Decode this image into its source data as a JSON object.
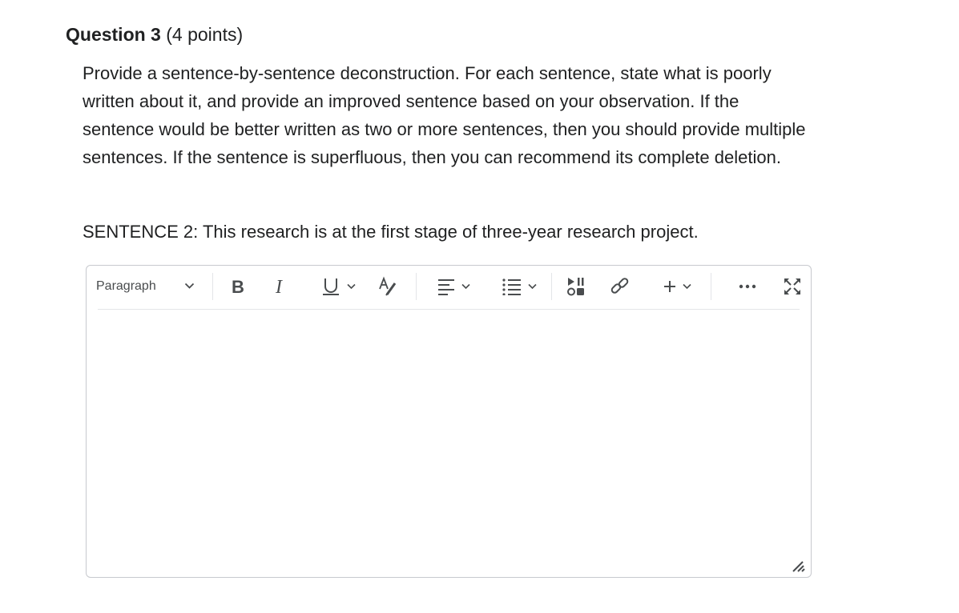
{
  "question": {
    "title": "Question 3",
    "points": "(4 points)",
    "prompt": "Provide a sentence-by-sentence deconstruction. For each sentence, state what is poorly written about it, and provide an improved sentence based on your observation. If the sentence would be better written as two or more sentences, then you should provide multiple sentences. If the sentence is superfluous, then you can recommend its complete deletion.",
    "sentence": "SENTENCE 2: This research is at the first stage of three-year research project."
  },
  "editor": {
    "format_select": "Paragraph",
    "body_text": "",
    "toolbar_icons": [
      "bold-icon",
      "italic-icon",
      "underline-icon",
      "text-color-icon",
      "align-icon",
      "list-icon",
      "insert-media-icon",
      "link-icon",
      "insert-plus-icon",
      "more-icon",
      "fullscreen-icon"
    ]
  }
}
